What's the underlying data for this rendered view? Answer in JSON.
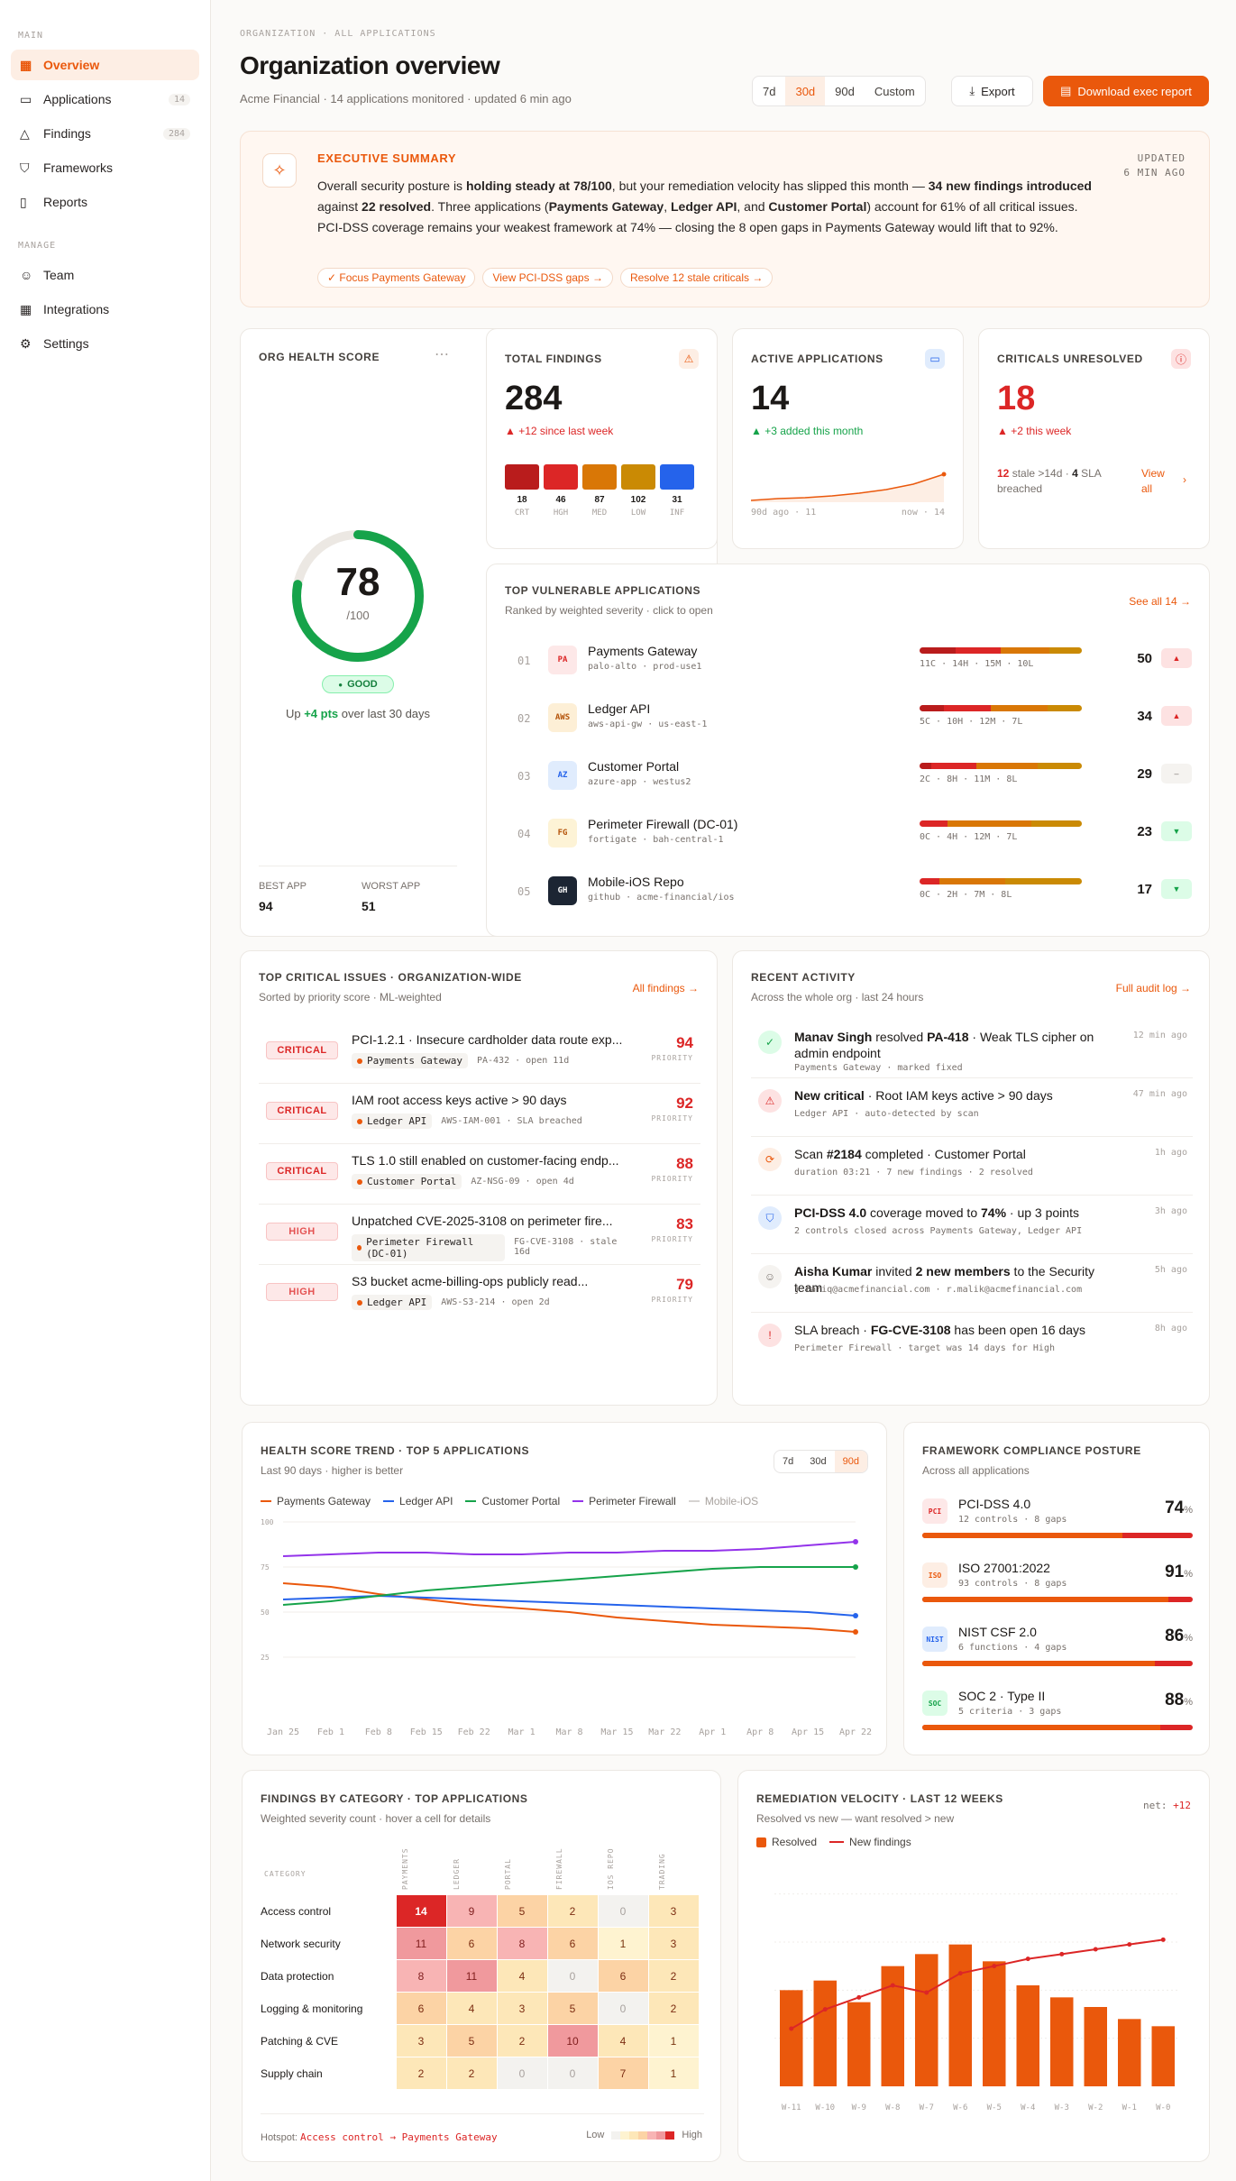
{
  "sidebar": {
    "main_label": "MAIN",
    "manage_label": "MANAGE",
    "items": [
      {
        "label": "Overview",
        "icon": "grid-icon"
      },
      {
        "label": "Applications",
        "icon": "monitor-icon",
        "count": "14"
      },
      {
        "label": "Findings",
        "icon": "warning-icon",
        "count": "284"
      },
      {
        "label": "Frameworks",
        "icon": "shield-icon"
      },
      {
        "label": "Reports",
        "icon": "document-icon"
      }
    ],
    "manage": [
      {
        "label": "Team",
        "icon": "users-icon"
      },
      {
        "label": "Integrations",
        "icon": "grid-icon"
      },
      {
        "label": "Settings",
        "icon": "gear-icon"
      }
    ]
  },
  "header": {
    "breadcrumb": "ORGANIZATION · ALL APPLICATIONS",
    "title": "Organization overview",
    "subtitle": "Acme Financial · 14 applications monitored · updated 6 min ago",
    "ranges": [
      "7d",
      "30d",
      "90d",
      "Custom"
    ],
    "export": "Export",
    "download": "Download exec report"
  },
  "summary": {
    "title": "EXECUTIVE SUMMARY",
    "updated1": "UPDATED",
    "updated2": "6 MIN AGO",
    "chips": [
      "✓  Focus Payments Gateway",
      "View PCI-DSS gaps →",
      "Resolve 12 stale criticals →"
    ]
  },
  "health": {
    "title": "ORG HEALTH SCORE",
    "score": "78",
    "of": "/100",
    "status": "GOOD",
    "note_a": "Up ",
    "note_b": "+4 pts",
    "note_c": " over last 30 days",
    "best_label": "BEST APP",
    "best": "94",
    "worst_label": "WORST APP",
    "worst": "51",
    "value": 0.78
  },
  "total": {
    "title": "TOTAL FINDINGS",
    "value": "284",
    "delta": "▲ +12 since last week",
    "bars": [
      {
        "v": "18",
        "l": "CRT",
        "c": "#b91c1c"
      },
      {
        "v": "46",
        "l": "HGH",
        "c": "#dc2626"
      },
      {
        "v": "87",
        "l": "MED",
        "c": "#d97706"
      },
      {
        "v": "102",
        "l": "LOW",
        "c": "#ca8a04"
      },
      {
        "v": "31",
        "l": "INF",
        "c": "#2563eb"
      }
    ]
  },
  "active": {
    "title": "ACTIVE APPLICATIONS",
    "value": "14",
    "delta": "▲ +3 added this month",
    "from": "90d ago · 11",
    "to": "now · 14"
  },
  "criticals": {
    "title": "CRITICALS UNRESOLVED",
    "value": "18",
    "delta": "▲ +2 this week",
    "n1": "12",
    "t1": " stale >14d · ",
    "n2": "4",
    "t2": " SLA breached",
    "link": "View all"
  },
  "vuln": {
    "title": "TOP VULNERABLE APPLICATIONS",
    "sub": "Ranked by weighted severity · click to open",
    "link": "See all 14 →",
    "apps": [
      {
        "rank": "01",
        "abbr": "PA",
        "name": "Payments Gateway",
        "meta": "palo-alto · prod-use1",
        "counts": "11C · 14H · 15M · 10L",
        "score": "50",
        "trend": "▲",
        "abg": "#fde8e8",
        "afg": "#dc2626",
        "tbg": "#fde2e2",
        "tfg": "#dc2626",
        "seg": [
          0.22,
          0.28,
          0.3,
          0.2
        ]
      },
      {
        "rank": "02",
        "abbr": "AWS",
        "name": "Ledger API",
        "meta": "aws-api-gw · us-east-1",
        "counts": "5C · 10H · 12M · 7L",
        "score": "34",
        "trend": "▲",
        "abg": "#fdefd6",
        "afg": "#b45309",
        "tbg": "#fde2e2",
        "tfg": "#dc2626",
        "seg": [
          0.15,
          0.29,
          0.35,
          0.21
        ]
      },
      {
        "rank": "03",
        "abbr": "AZ",
        "name": "Customer Portal",
        "meta": "azure-app · westus2",
        "counts": "2C · 8H · 11M · 8L",
        "score": "29",
        "trend": "–",
        "abg": "#e0ecfd",
        "afg": "#2563eb",
        "tbg": "#f5f3f0",
        "tfg": "#78716c",
        "seg": [
          0.07,
          0.28,
          0.38,
          0.27
        ]
      },
      {
        "rank": "04",
        "abbr": "FG",
        "name": "Perimeter Firewall (DC-01)",
        "meta": "fortigate · bah-central-1",
        "counts": "0C · 4H · 12M · 7L",
        "score": "23",
        "trend": "▼",
        "abg": "#fdf3d6",
        "afg": "#b45309",
        "tbg": "#dcfce7",
        "tfg": "#16a34a",
        "seg": [
          0,
          0.17,
          0.52,
          0.31
        ]
      },
      {
        "rank": "05",
        "abbr": "GH",
        "name": "Mobile-iOS Repo",
        "meta": "github · acme-financial/ios",
        "counts": "0C · 2H · 7M · 8L",
        "score": "17",
        "trend": "▼",
        "abg": "#1c2533",
        "afg": "#ffffff",
        "tbg": "#dcfce7",
        "tfg": "#16a34a",
        "seg": [
          0,
          0.12,
          0.41,
          0.47
        ]
      }
    ]
  },
  "issues": {
    "title": "TOP CRITICAL ISSUES · ORGANIZATION-WIDE",
    "sub": "Sorted by priority score · ML-weighted",
    "link": "All findings →",
    "prio": "PRIORITY",
    "items": [
      {
        "sev": "CRITICAL",
        "cls": "critical",
        "title": "PCI-1.2.1 · Insecure cardholder data route exp...",
        "app": "Payments Gateway",
        "meta": "PA-432 · open 11d",
        "score": "94"
      },
      {
        "sev": "CRITICAL",
        "cls": "critical",
        "title": "IAM root access keys active > 90 days",
        "app": "Ledger API",
        "meta": "AWS-IAM-001 · SLA breached",
        "score": "92"
      },
      {
        "sev": "CRITICAL",
        "cls": "critical",
        "title": "TLS 1.0 still enabled on customer-facing endp...",
        "app": "Customer Portal",
        "meta": "AZ-NSG-09 · open 4d",
        "score": "88"
      },
      {
        "sev": "HIGH",
        "cls": "high",
        "title": "Unpatched CVE-2025-3108 on perimeter fire...",
        "app": "Perimeter Firewall (DC-01)",
        "meta": "FG-CVE-3108 · stale 16d",
        "score": "83"
      },
      {
        "sev": "HIGH",
        "cls": "high",
        "title": "S3 bucket acme-billing-ops publicly read...",
        "app": "Ledger API",
        "meta": "AWS-S3-214 · open 2d",
        "score": "79"
      }
    ]
  },
  "activity": {
    "title": "RECENT ACTIVITY",
    "sub": "Across the whole org · last 24 hours",
    "link": "Full audit log →",
    "items": [
      {
        "icon": "check-icon",
        "glyph": "✓",
        "bg": "#dcfce7",
        "fg": "#16a34a",
        "b1": "Manav Singh",
        "t1": " resolved ",
        "b2": "PA-418",
        "t2": " · Weak TLS cipher on admin endpoint",
        "meta": "Payments Gateway · marked fixed",
        "time": "12 min ago"
      },
      {
        "icon": "warning-icon",
        "glyph": "⚠",
        "bg": "#fde2e2",
        "fg": "#dc2626",
        "b1": "New critical",
        "t1": " · Root IAM keys active > 90 days",
        "b2": "",
        "t2": "",
        "meta": "Ledger API · auto-detected by scan",
        "time": "47 min ago"
      },
      {
        "icon": "refresh-icon",
        "glyph": "⟳",
        "bg": "#fdeee4",
        "fg": "#ea580c",
        "b1": "",
        "t1": "Scan ",
        "b2": "#2184",
        "t2": " completed · Customer Portal",
        "meta": "duration 03:21 · 7 new findings · 2 resolved",
        "time": "1h ago"
      },
      {
        "icon": "shield-icon",
        "glyph": "⛉",
        "bg": "#e0ecfd",
        "fg": "#2563eb",
        "b1": "PCI-DSS 4.0",
        "t1": " coverage moved to ",
        "b2": "74%",
        "t2": " · up 3 points",
        "meta": "2 controls closed across Payments Gateway, Ledger API",
        "time": "3h ago"
      },
      {
        "icon": "user-icon",
        "glyph": "☺",
        "bg": "#f5f3f0",
        "fg": "#78716c",
        "b1": "Aisha Kumar",
        "t1": " invited ",
        "b2": "2 new members",
        "t2": " to the Security team",
        "meta": "j.tariq@acmefinancial.com · r.malik@acmefinancial.com",
        "time": "5h ago"
      },
      {
        "icon": "alert-icon",
        "glyph": "!",
        "bg": "#fde2e2",
        "fg": "#dc2626",
        "b1": "",
        "t1": "SLA breach · ",
        "b2": "FG-CVE-3108",
        "t2": " has been open 16 days",
        "meta": "Perimeter Firewall · target was 14 days for High",
        "time": "8h ago"
      }
    ]
  },
  "trend": {
    "title": "HEALTH SCORE TREND · TOP 5 APPLICATIONS",
    "sub": "Last 90 days · higher is better",
    "ranges": [
      "7d",
      "30d",
      "90d"
    ]
  },
  "frameworks": {
    "title": "FRAMEWORK COMPLIANCE POSTURE",
    "sub": "Across all applications",
    "items": [
      {
        "abbr": "PCI",
        "name": "PCI-DSS 4.0",
        "meta": "12 controls · 8 gaps",
        "pct": "74",
        "bg": "#fde8e8",
        "fg": "#dc2626",
        "v": 0.74
      },
      {
        "abbr": "ISO",
        "name": "ISO 27001:2022",
        "meta": "93 controls · 8 gaps",
        "pct": "91",
        "bg": "#fdeee4",
        "fg": "#ea580c",
        "v": 0.91
      },
      {
        "abbr": "NIST",
        "name": "NIST CSF 2.0",
        "meta": "6 functions · 4 gaps",
        "pct": "86",
        "bg": "#e0ecfd",
        "fg": "#2563eb",
        "v": 0.86
      },
      {
        "abbr": "SOC",
        "name": "SOC 2 · Type II",
        "meta": "5 criteria · 3 gaps",
        "pct": "88",
        "bg": "#dcfce7",
        "fg": "#16a34a",
        "v": 0.88
      }
    ]
  },
  "heatmap": {
    "title": "FINDINGS BY CATEGORY · TOP APPLICATIONS",
    "sub": "Weighted severity count · hover a cell for details",
    "cat_label": "CATEGORY",
    "cols": [
      "PAYMENTS",
      "LEDGER",
      "PORTAL",
      "FIREWALL",
      "IOS REPO",
      "TRADING"
    ],
    "rows": [
      {
        "name": "Access control",
        "v": [
          14,
          9,
          5,
          2,
          0,
          3
        ]
      },
      {
        "name": "Network security",
        "v": [
          11,
          6,
          8,
          6,
          1,
          3
        ]
      },
      {
        "name": "Data protection",
        "v": [
          8,
          11,
          4,
          0,
          6,
          2
        ]
      },
      {
        "name": "Logging & monitoring",
        "v": [
          6,
          4,
          3,
          5,
          0,
          2
        ]
      },
      {
        "name": "Patching & CVE",
        "v": [
          3,
          5,
          2,
          10,
          4,
          1
        ]
      },
      {
        "name": "Supply chain",
        "v": [
          2,
          2,
          0,
          0,
          7,
          1
        ]
      }
    ],
    "hotspot_label": "Hotspot:",
    "hotspot": "Access control → Payments Gateway",
    "low": "Low",
    "high": "High"
  },
  "velocity": {
    "title": "REMEDIATION VELOCITY · LAST 12 WEEKS",
    "sub": "Resolved vs new — want resolved > new",
    "net_label": "net:",
    "net": "+12",
    "legend_resolved": "Resolved",
    "legend_new": "New findings"
  },
  "chart_data": [
    {
      "type": "line",
      "title": "HEALTH SCORE TREND · TOP 5 APPLICATIONS",
      "x": [
        "Jan 25",
        "Feb 1",
        "Feb 8",
        "Feb 15",
        "Feb 22",
        "Mar 1",
        "Mar 8",
        "Mar 15",
        "Mar 22",
        "Apr 1",
        "Apr 8",
        "Apr 15",
        "Apr 22"
      ],
      "ylim": [
        0,
        100
      ],
      "yticks": [
        25,
        50,
        75,
        100
      ],
      "series": [
        {
          "name": "Payments Gateway",
          "color": "#ea580c",
          "values": [
            66,
            64,
            60,
            57,
            54,
            52,
            50,
            47,
            45,
            43,
            42,
            41,
            39
          ]
        },
        {
          "name": "Ledger API",
          "color": "#2563eb",
          "values": [
            57,
            58,
            59,
            58,
            57,
            56,
            55,
            54,
            53,
            52,
            51,
            50,
            48
          ]
        },
        {
          "name": "Customer Portal",
          "color": "#16a34a",
          "values": [
            54,
            56,
            59,
            62,
            64,
            66,
            68,
            70,
            72,
            74,
            75,
            75,
            75
          ]
        },
        {
          "name": "Perimeter Firewall",
          "color": "#9333ea",
          "values": [
            81,
            82,
            83,
            83,
            82,
            82,
            83,
            83,
            84,
            84,
            85,
            87,
            89
          ]
        },
        {
          "name": "Mobile-iOS",
          "color": "#d6d3d1",
          "values": []
        }
      ]
    },
    {
      "type": "bar",
      "title": "REMEDIATION VELOCITY · LAST 12 WEEKS",
      "categories": [
        "W-11",
        "W-10",
        "W-9",
        "W-8",
        "W-7",
        "W-6",
        "W-5",
        "W-4",
        "W-3",
        "W-2",
        "W-1",
        "W-0"
      ],
      "series": [
        {
          "name": "Resolved",
          "type": "bar",
          "color": "#ea580c",
          "values": [
            40,
            44,
            35,
            50,
            55,
            59,
            52,
            42,
            37,
            33,
            28,
            25
          ]
        },
        {
          "name": "New findings",
          "type": "line",
          "color": "#dc2626",
          "values": [
            24,
            32,
            37,
            42,
            39,
            47,
            50,
            53,
            55,
            57,
            59,
            61
          ]
        }
      ],
      "ylim": [
        0,
        90
      ]
    }
  ]
}
